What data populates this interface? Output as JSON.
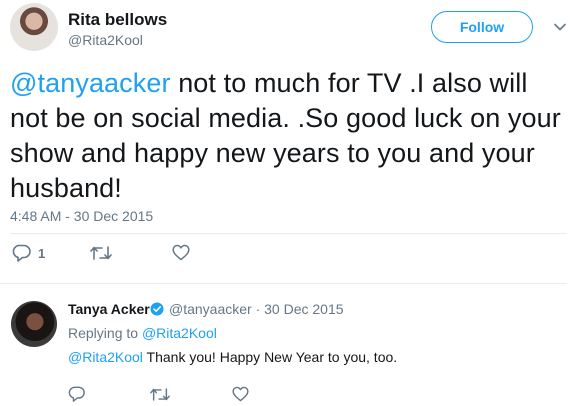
{
  "main_tweet": {
    "author_name": "Rita bellows",
    "author_handle": "@Rita2Kool",
    "follow_label": "Follow",
    "mention": "@tanyaacker",
    "text": " not to much for TV .I also will not be on social media. .So good luck on your show and happy new years to you and your husband!",
    "timestamp": "4:48 AM - 30 Dec 2015",
    "reply_count": "1",
    "icons": [
      "reply-icon",
      "retweet-icon",
      "like-icon",
      "chevron-down-icon"
    ]
  },
  "reply_tweet": {
    "author_name": "Tanya Acker",
    "meta": "@tanyaacker · 30 Dec 2015",
    "replying_prefix": "Replying to ",
    "replying_to": "@Rita2Kool",
    "mention": "@Rita2Kool",
    "text": " Thank you! Happy New Year to you, too.",
    "icons": [
      "verified-badge-icon",
      "reply-icon",
      "retweet-icon",
      "like-icon"
    ]
  },
  "colors": {
    "link": "#1da1f2",
    "secondary_text": "#657786",
    "divider": "#e6ecf0"
  }
}
